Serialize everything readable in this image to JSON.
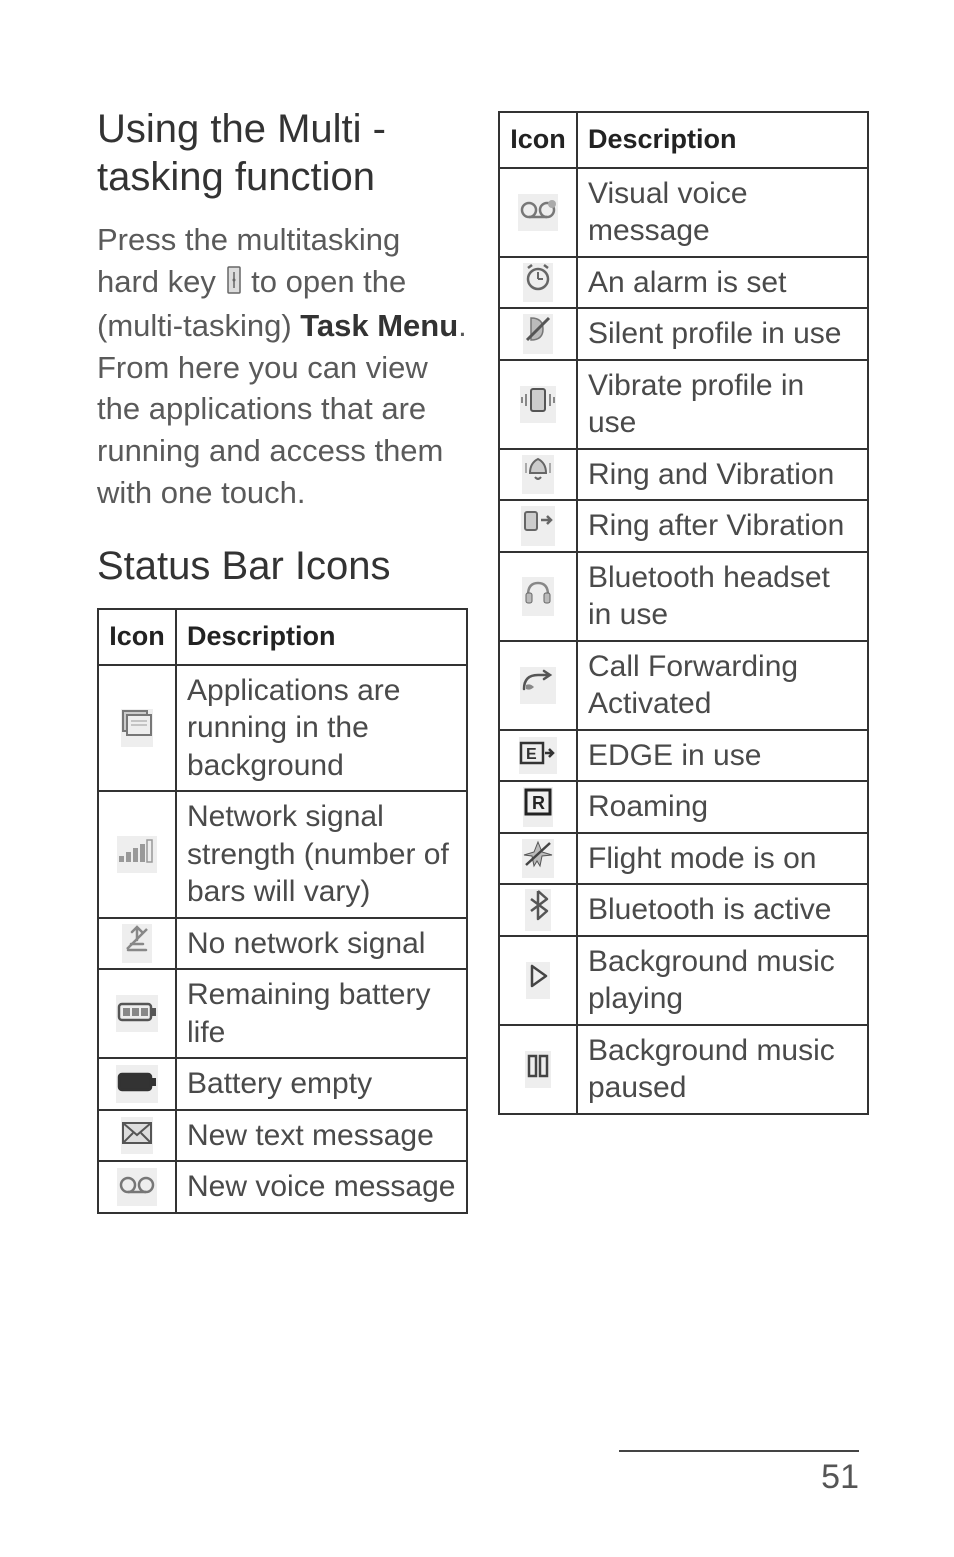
{
  "left": {
    "heading1": "Using the Multi - tasking function",
    "para1_a": "Press the multitasking hard key ",
    "para1_b": " to open the (multi-tasking) ",
    "para1_bold": "Task Menu",
    "para1_c": ". From here you can view the applications that are running and access them with one touch.",
    "heading2": "Status Bar Icons",
    "table_headers": {
      "icon": "Icon",
      "desc": "Description"
    },
    "rows": [
      {
        "icon": "apps-running-icon",
        "desc": "Applications are running in the background"
      },
      {
        "icon": "signal-bars-icon",
        "desc": "Network signal strength (number of bars will vary)"
      },
      {
        "icon": "no-signal-icon",
        "desc": "No network signal"
      },
      {
        "icon": "battery-full-icon",
        "desc": "Remaining battery life"
      },
      {
        "icon": "battery-empty-icon",
        "desc": "Battery empty"
      },
      {
        "icon": "envelope-icon",
        "desc": "New text message"
      },
      {
        "icon": "voicemail-icon",
        "desc": "New voice message"
      }
    ]
  },
  "right": {
    "table_headers": {
      "icon": "Icon",
      "desc": "Description"
    },
    "rows": [
      {
        "icon": "visual-voicemail-icon",
        "desc": "Visual voice message"
      },
      {
        "icon": "alarm-clock-icon",
        "desc": "An alarm is set"
      },
      {
        "icon": "silent-profile-icon",
        "desc": "Silent profile in use"
      },
      {
        "icon": "vibrate-profile-icon",
        "desc": "Vibrate profile in use"
      },
      {
        "icon": "ring-vibration-icon",
        "desc": "Ring and Vibration"
      },
      {
        "icon": "ring-after-vibration-icon",
        "desc": "Ring after Vibration"
      },
      {
        "icon": "bluetooth-headset-icon",
        "desc": "Bluetooth headset in use"
      },
      {
        "icon": "call-forwarding-icon",
        "desc": "Call Forwarding Activated"
      },
      {
        "icon": "edge-icon",
        "desc": "EDGE in use"
      },
      {
        "icon": "roaming-icon",
        "desc": "Roaming"
      },
      {
        "icon": "flight-mode-icon",
        "desc": "Flight mode is on"
      },
      {
        "icon": "bluetooth-active-icon",
        "desc": "Bluetooth is active"
      },
      {
        "icon": "music-playing-icon",
        "desc": "Background music playing"
      },
      {
        "icon": "music-paused-icon",
        "desc": "Background music paused"
      }
    ]
  },
  "page_number": "51"
}
